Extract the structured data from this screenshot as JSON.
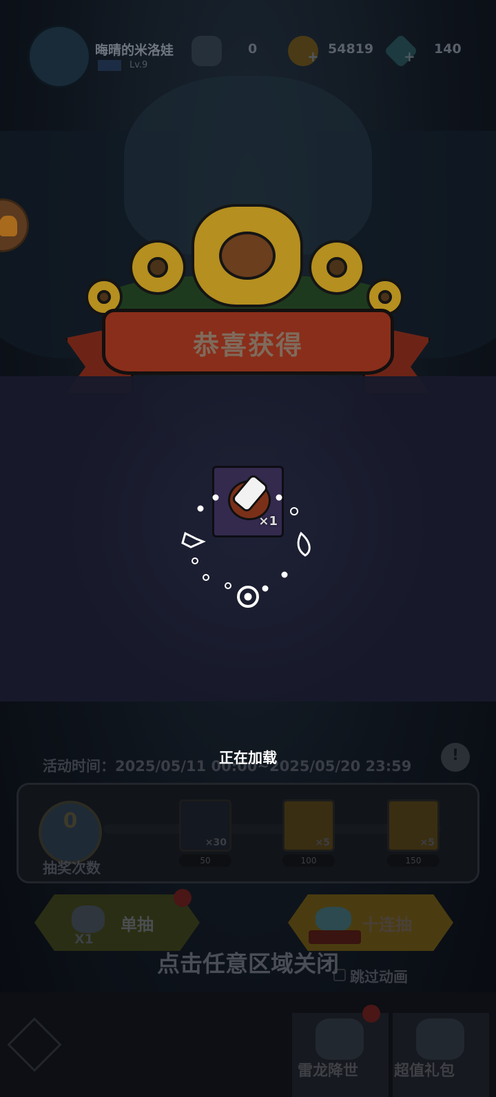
{
  "player": {
    "name": "晦晴的米洛娃",
    "level": "Lv.9"
  },
  "resources": {
    "wings": "0",
    "gold": "54819",
    "gems": "140"
  },
  "banner": {
    "title": "恭喜获得"
  },
  "reward": {
    "count": "×1"
  },
  "status": {
    "loading": "正在加载"
  },
  "activity": {
    "time": "活动时间：2025/05/11 00:00~2025/05/20 23:59",
    "draw_count": "0",
    "draw_count_label": "抽奖次数",
    "milestones": [
      {
        "qty": "×30",
        "threshold": "50"
      },
      {
        "qty": "×5",
        "threshold": "100"
      },
      {
        "qty": "×5",
        "threshold": "150"
      }
    ]
  },
  "buttons": {
    "single_label": "单抽",
    "single_cost": "X1",
    "ten_label": "十连抽"
  },
  "hints": {
    "close": "点击任意区域关闭",
    "skip": "跳过动画"
  },
  "bottom_tabs": [
    {
      "label": "雷龙降世",
      "icon": "dragon-icon"
    },
    {
      "label": "超值礼包",
      "icon": "gift-icon"
    }
  ],
  "colors": {
    "overlay": "#181a2b",
    "ribbon": "#892e1a",
    "flower": "#b58f1f"
  }
}
